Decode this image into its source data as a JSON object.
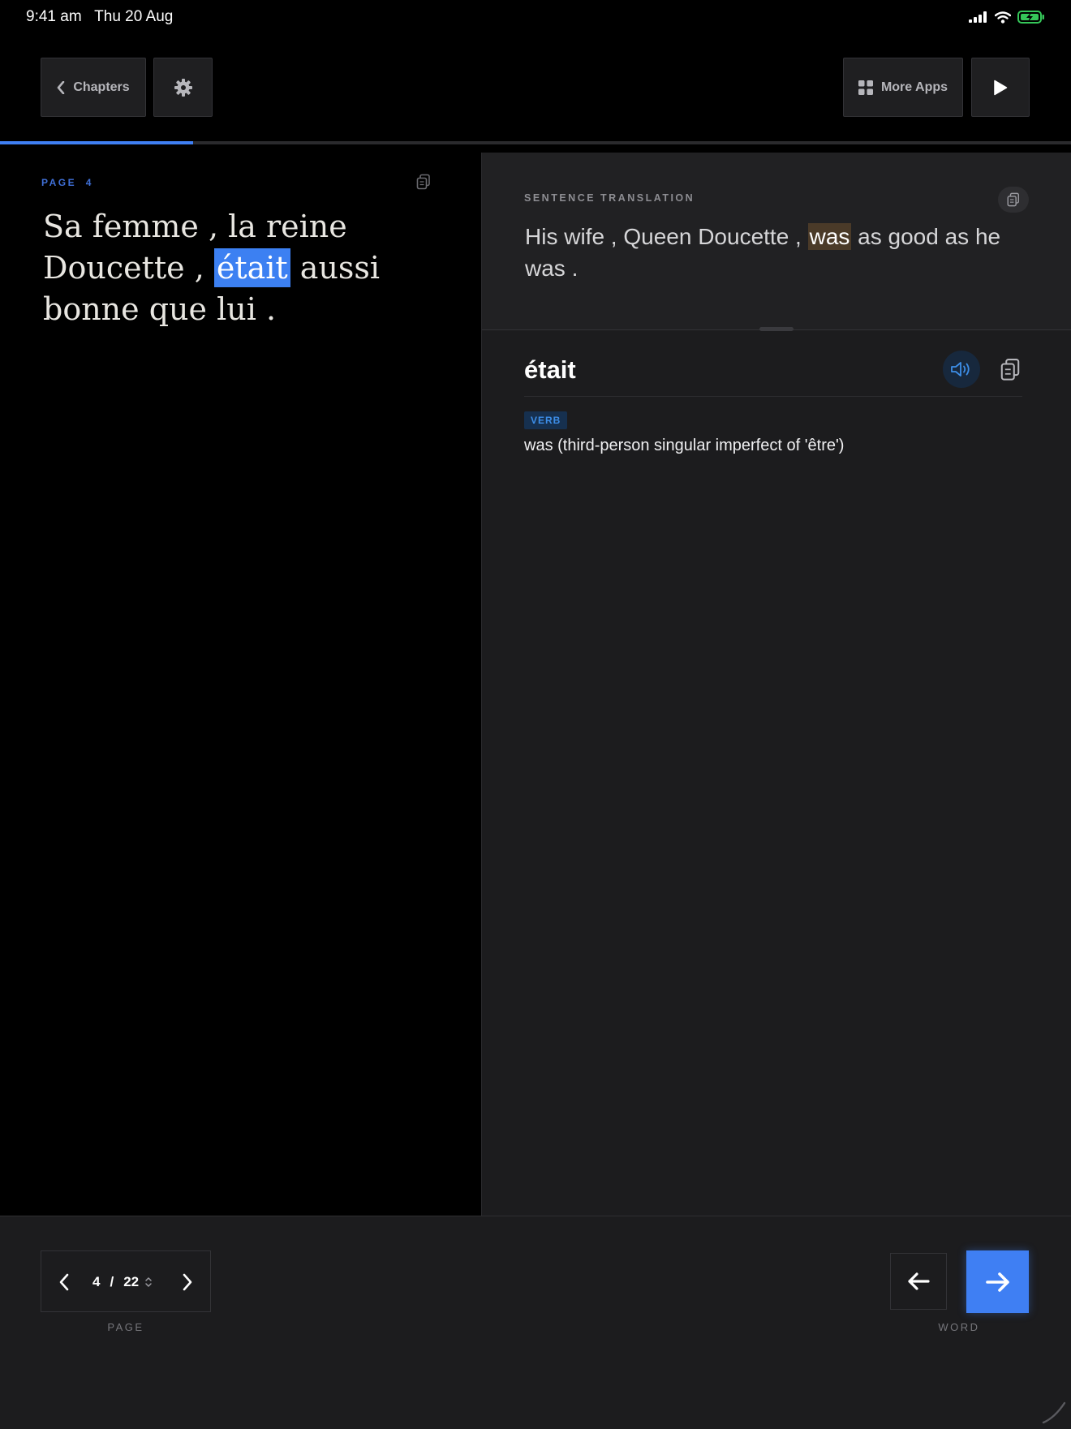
{
  "status_bar": {
    "time": "9:41 am",
    "date": "Thu 20 Aug",
    "icons": [
      "cellular-signal-icon",
      "wifi-icon",
      "battery-charging-icon"
    ]
  },
  "toolbar": {
    "chapters_label": "Chapters",
    "more_apps_label": "More Apps",
    "icons": [
      "chevron-left-icon",
      "gear-icon",
      "grid-icon",
      "play-icon"
    ]
  },
  "reading_progress": 0.18,
  "source": {
    "page_label": "PAGE  4",
    "text_before": "Sa femme , la reine Doucette , ",
    "highlighted_word": "était",
    "text_after": " aussi bonne que lui ."
  },
  "translation": {
    "label": "SENTENCE TRANSLATION",
    "text_before": "His wife , Queen Doucette , ",
    "highlighted_word": "was",
    "text_after": " as good as he was ."
  },
  "word_detail": {
    "word": "était",
    "part_of_speech": "VERB",
    "definition": "was (third-person singular imperfect of 'être')",
    "icons": [
      "speaker-icon",
      "copy-icon"
    ]
  },
  "bottom": {
    "current_page": "4",
    "separator": "/",
    "total_pages": "22",
    "page_label": "PAGE",
    "word_label": "WORD"
  },
  "colors": {
    "accent": "#3f7ff3",
    "translation_highlight": "#4a3a28",
    "background": "#000000",
    "panel": "#1c1c1e"
  }
}
